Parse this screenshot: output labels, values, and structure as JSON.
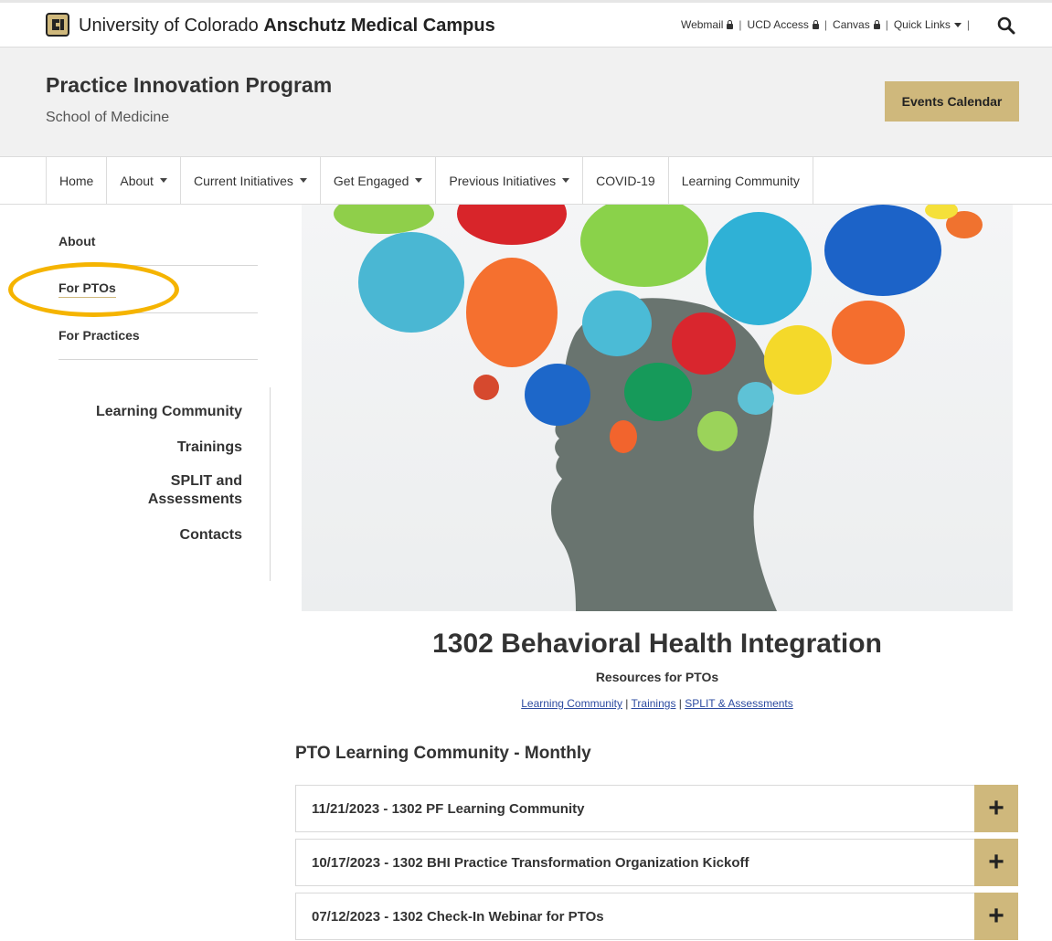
{
  "topbar": {
    "brand_prefix": "University of Colorado",
    "brand_bold": "Anschutz Medical Campus",
    "links": [
      {
        "label": "Webmail",
        "icon": "lock-icon"
      },
      {
        "label": "UCD Access",
        "icon": "lock-icon"
      },
      {
        "label": "Canvas",
        "icon": "lock-icon"
      },
      {
        "label": "Quick Links",
        "icon": "caret-down-icon"
      }
    ]
  },
  "header": {
    "title": "Practice Innovation Program",
    "subtitle": "School of Medicine",
    "events_button": "Events Calendar"
  },
  "nav": {
    "items": [
      {
        "label": "Home",
        "dropdown": false
      },
      {
        "label": "About",
        "dropdown": true
      },
      {
        "label": "Current Initiatives",
        "dropdown": true
      },
      {
        "label": "Get Engaged",
        "dropdown": true
      },
      {
        "label": "Previous Initiatives",
        "dropdown": true
      },
      {
        "label": "COVID-19",
        "dropdown": false
      },
      {
        "label": "Learning Community",
        "dropdown": false
      }
    ]
  },
  "sidebar": {
    "items": [
      "About",
      "For PTOs",
      "For Practices"
    ],
    "sub_items": [
      "Learning Community",
      "Trainings",
      "SPLIT and Assessments",
      "Contacts"
    ]
  },
  "main": {
    "title": "1302 Behavioral Health Integration",
    "subtitle": "Resources for PTOs",
    "links": [
      "Learning Community",
      "Trainings",
      "SPLIT & Assessments"
    ],
    "section_title": "PTO Learning Community - Monthly",
    "accordion": [
      "11/21/2023 - 1302 PF Learning Community",
      "10/17/2023 - 1302 BHI Practice Transformation Organization Kickoff",
      "07/12/2023 - 1302 Check-In Webinar for PTOs"
    ],
    "expand_symbol": "+"
  },
  "colors": {
    "gold": "#cfb87c",
    "highlight": "#f5b400",
    "link": "#2c4ba0"
  }
}
